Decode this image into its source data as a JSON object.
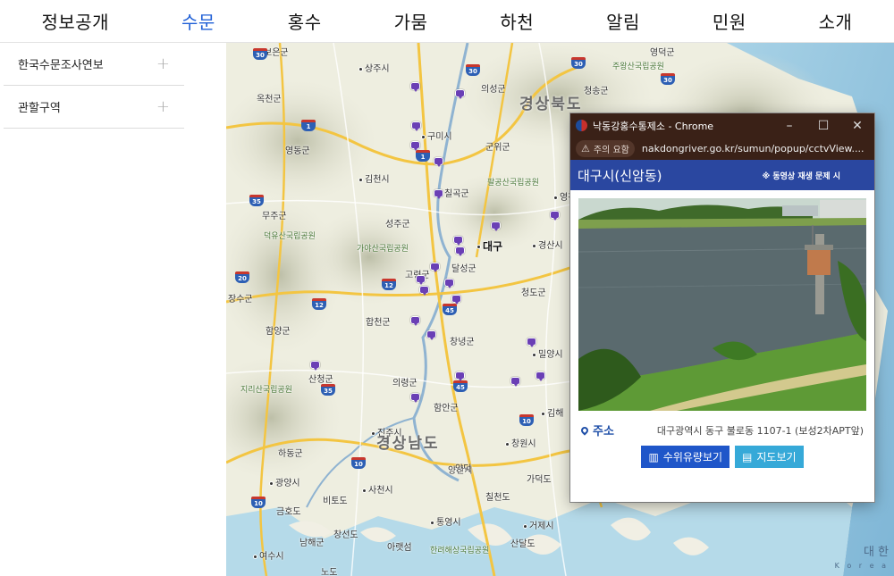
{
  "nav": {
    "items": [
      {
        "label": "정보공개"
      },
      {
        "label": "수문"
      },
      {
        "label": "홍수"
      },
      {
        "label": "가뭄"
      },
      {
        "label": "하천"
      },
      {
        "label": "알림"
      },
      {
        "label": "민원"
      },
      {
        "label": "소개"
      }
    ],
    "active_index": 1,
    "active_color": "#1f5fd6"
  },
  "sidebar": {
    "items": [
      {
        "label": "한국수문조사연보",
        "icon": "plus-icon",
        "icon_glyph": "+"
      },
      {
        "label": "관할구역",
        "icon": "plus-icon",
        "icon_glyph": "+"
      }
    ]
  },
  "map": {
    "regions": [
      "경상북도",
      "경상남도"
    ],
    "cities": [
      "보은군",
      "상주시",
      "의성군",
      "영덕군",
      "주왕산국립공원",
      "청송군",
      "옥천군",
      "구미시",
      "군위군",
      "영동군",
      "김천시",
      "칠곡군",
      "팔공산국립공원",
      "무주군",
      "성주군",
      "덕유산국립공원",
      "가야산국립공원",
      "대구",
      "경산시",
      "고령군",
      "달성군",
      "청도군",
      "합천군",
      "창녕군",
      "밀양시",
      "함양군",
      "산청군",
      "의령군",
      "지리산국립공원",
      "함안군",
      "김해",
      "진주시",
      "창원시",
      "하동군",
      "양산시",
      "광양시",
      "사천시",
      "칠천도",
      "비토도",
      "금호도",
      "통영시",
      "창선도",
      "거제시",
      "남해군",
      "아랫섬",
      "한려해상국립공원",
      "여수시",
      "노도",
      "산달도",
      "가덕도",
      "장수군",
      "양덕",
      "영천시"
    ],
    "shields": [
      "30",
      "30",
      "30",
      "30",
      "1",
      "1",
      "35",
      "20",
      "12",
      "12",
      "45",
      "45",
      "35",
      "10",
      "10",
      "10"
    ],
    "footer_lines": [
      "대 한",
      "K o r e a"
    ]
  },
  "popup": {
    "window_title": "낙동강홍수통제소 - Chrome",
    "controls": [
      "–",
      "☐",
      "✕"
    ],
    "warning_label": "주의 요함",
    "url": "nakdongriver.go.kr/sumun/popup/cctvView....",
    "station_name": "대구시(신암동)",
    "notice": "※ 동영상 재생 문제 시",
    "address_label": "주소",
    "address": "대구광역시 동구 불로동 1107-1 (보성2차APT앞)",
    "buttons": [
      {
        "label": "수위유량보기",
        "icon": "chart-icon"
      },
      {
        "label": "지도보기",
        "icon": "map-icon"
      }
    ]
  }
}
